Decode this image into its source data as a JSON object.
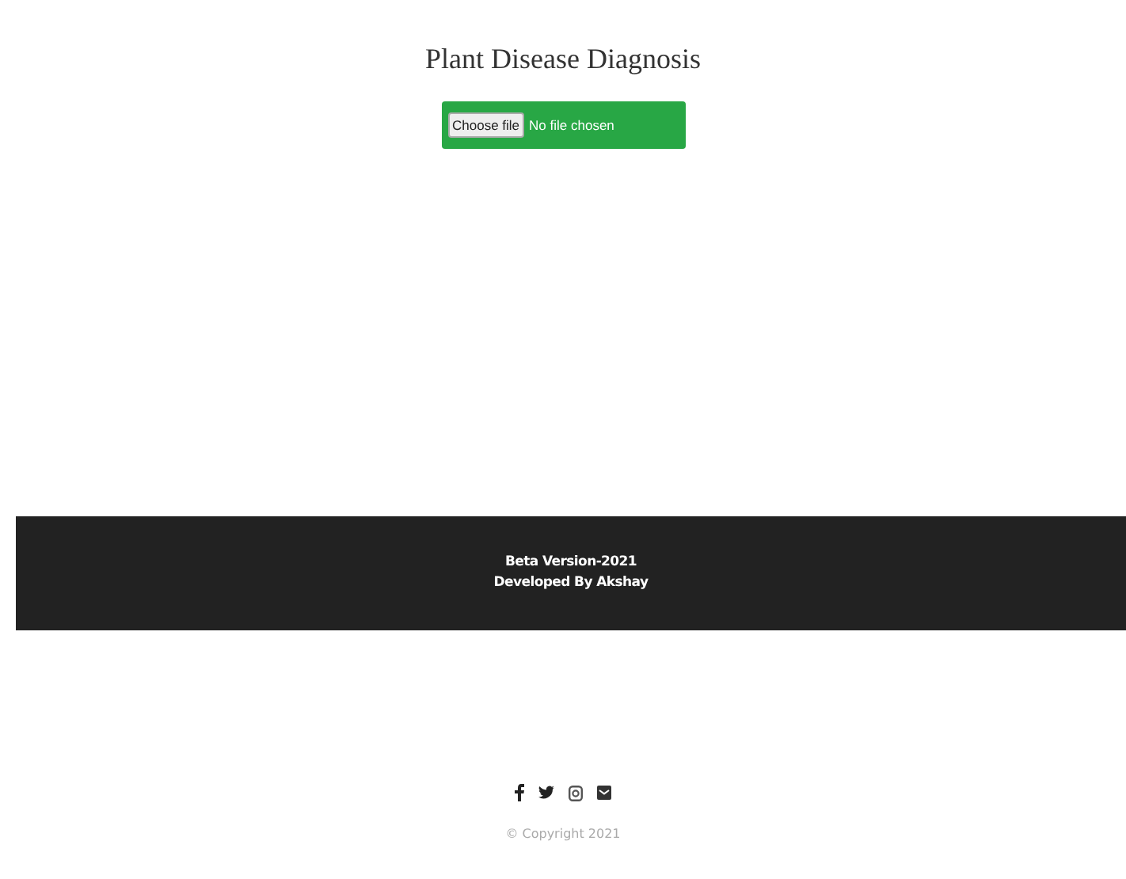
{
  "title": "Plant Disease Diagnosis",
  "upload": {
    "button": "Choose file",
    "status": "No file chosen"
  },
  "footer": {
    "lines": [
      "Beta Version-2021",
      "Developed By Akshay"
    ]
  },
  "copyright": "© Copyright 2021"
}
